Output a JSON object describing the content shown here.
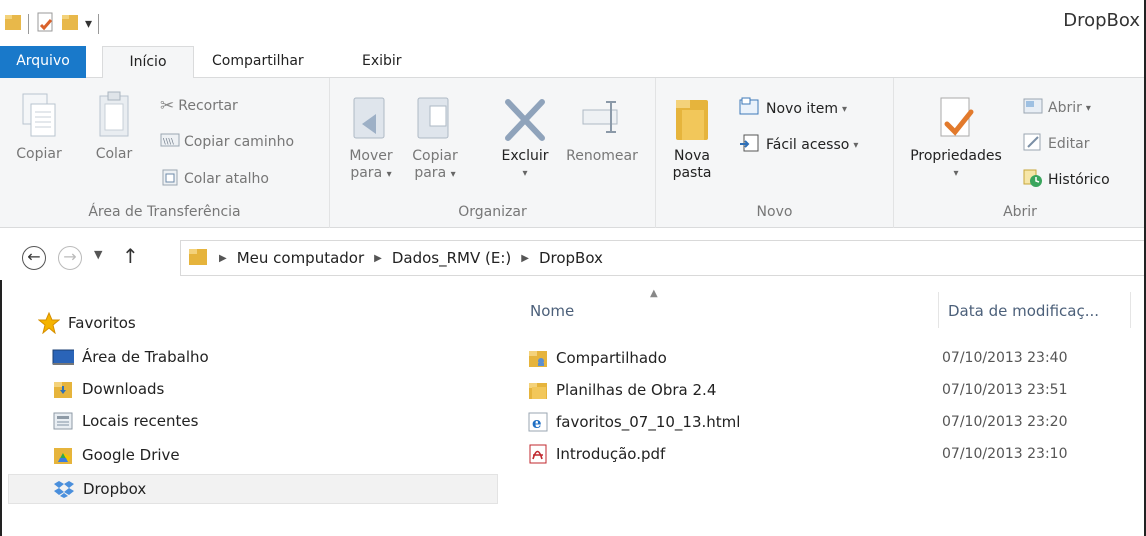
{
  "window": {
    "title": "DropBox"
  },
  "tabs": {
    "file": "Arquivo",
    "home": "Início",
    "share": "Compartilhar",
    "view": "Exibir"
  },
  "ribbon": {
    "clipboard": {
      "label": "Área de Transferência",
      "copy": "Copiar",
      "paste": "Colar",
      "cut": "Recortar",
      "copy_path": "Copiar caminho",
      "paste_shortcut": "Colar atalho"
    },
    "organize": {
      "label": "Organizar",
      "move_line1": "Mover",
      "move_line2": "para",
      "copyto_line1": "Copiar",
      "copyto_line2": "para",
      "delete": "Excluir",
      "rename": "Renomear"
    },
    "new": {
      "label": "Novo",
      "new_folder_line1": "Nova",
      "new_folder_line2": "pasta",
      "new_item": "Novo item",
      "easy_access": "Fácil acesso"
    },
    "open": {
      "label": "Abrir",
      "properties": "Propriedades",
      "open": "Abrir",
      "edit": "Editar",
      "history": "Histórico"
    }
  },
  "address": {
    "crumbs": [
      "Meu computador",
      "Dados_RMV (E:)",
      "DropBox"
    ]
  },
  "nav": {
    "favorites": "Favoritos",
    "items": [
      {
        "label": "Área de Trabalho",
        "icon": "desktop-icon"
      },
      {
        "label": "Downloads",
        "icon": "downloads-folder-icon"
      },
      {
        "label": "Locais recentes",
        "icon": "recent-places-icon"
      },
      {
        "label": "Google Drive",
        "icon": "google-drive-icon"
      },
      {
        "label": "Dropbox",
        "icon": "dropbox-icon",
        "selected": true
      }
    ]
  },
  "files": {
    "columns": {
      "name": "Nome",
      "date": "Data de modificaç..."
    },
    "rows": [
      {
        "name": "Compartilhado",
        "date": "07/10/2013 23:40",
        "icon": "shared-folder-icon"
      },
      {
        "name": "Planilhas de Obra 2.4",
        "date": "07/10/2013 23:51",
        "icon": "folder-icon"
      },
      {
        "name": "favoritos_07_10_13.html",
        "date": "07/10/2013 23:20",
        "icon": "ie-html-icon"
      },
      {
        "name": "Introdução.pdf",
        "date": "07/10/2013 23:10",
        "icon": "pdf-icon"
      }
    ]
  }
}
